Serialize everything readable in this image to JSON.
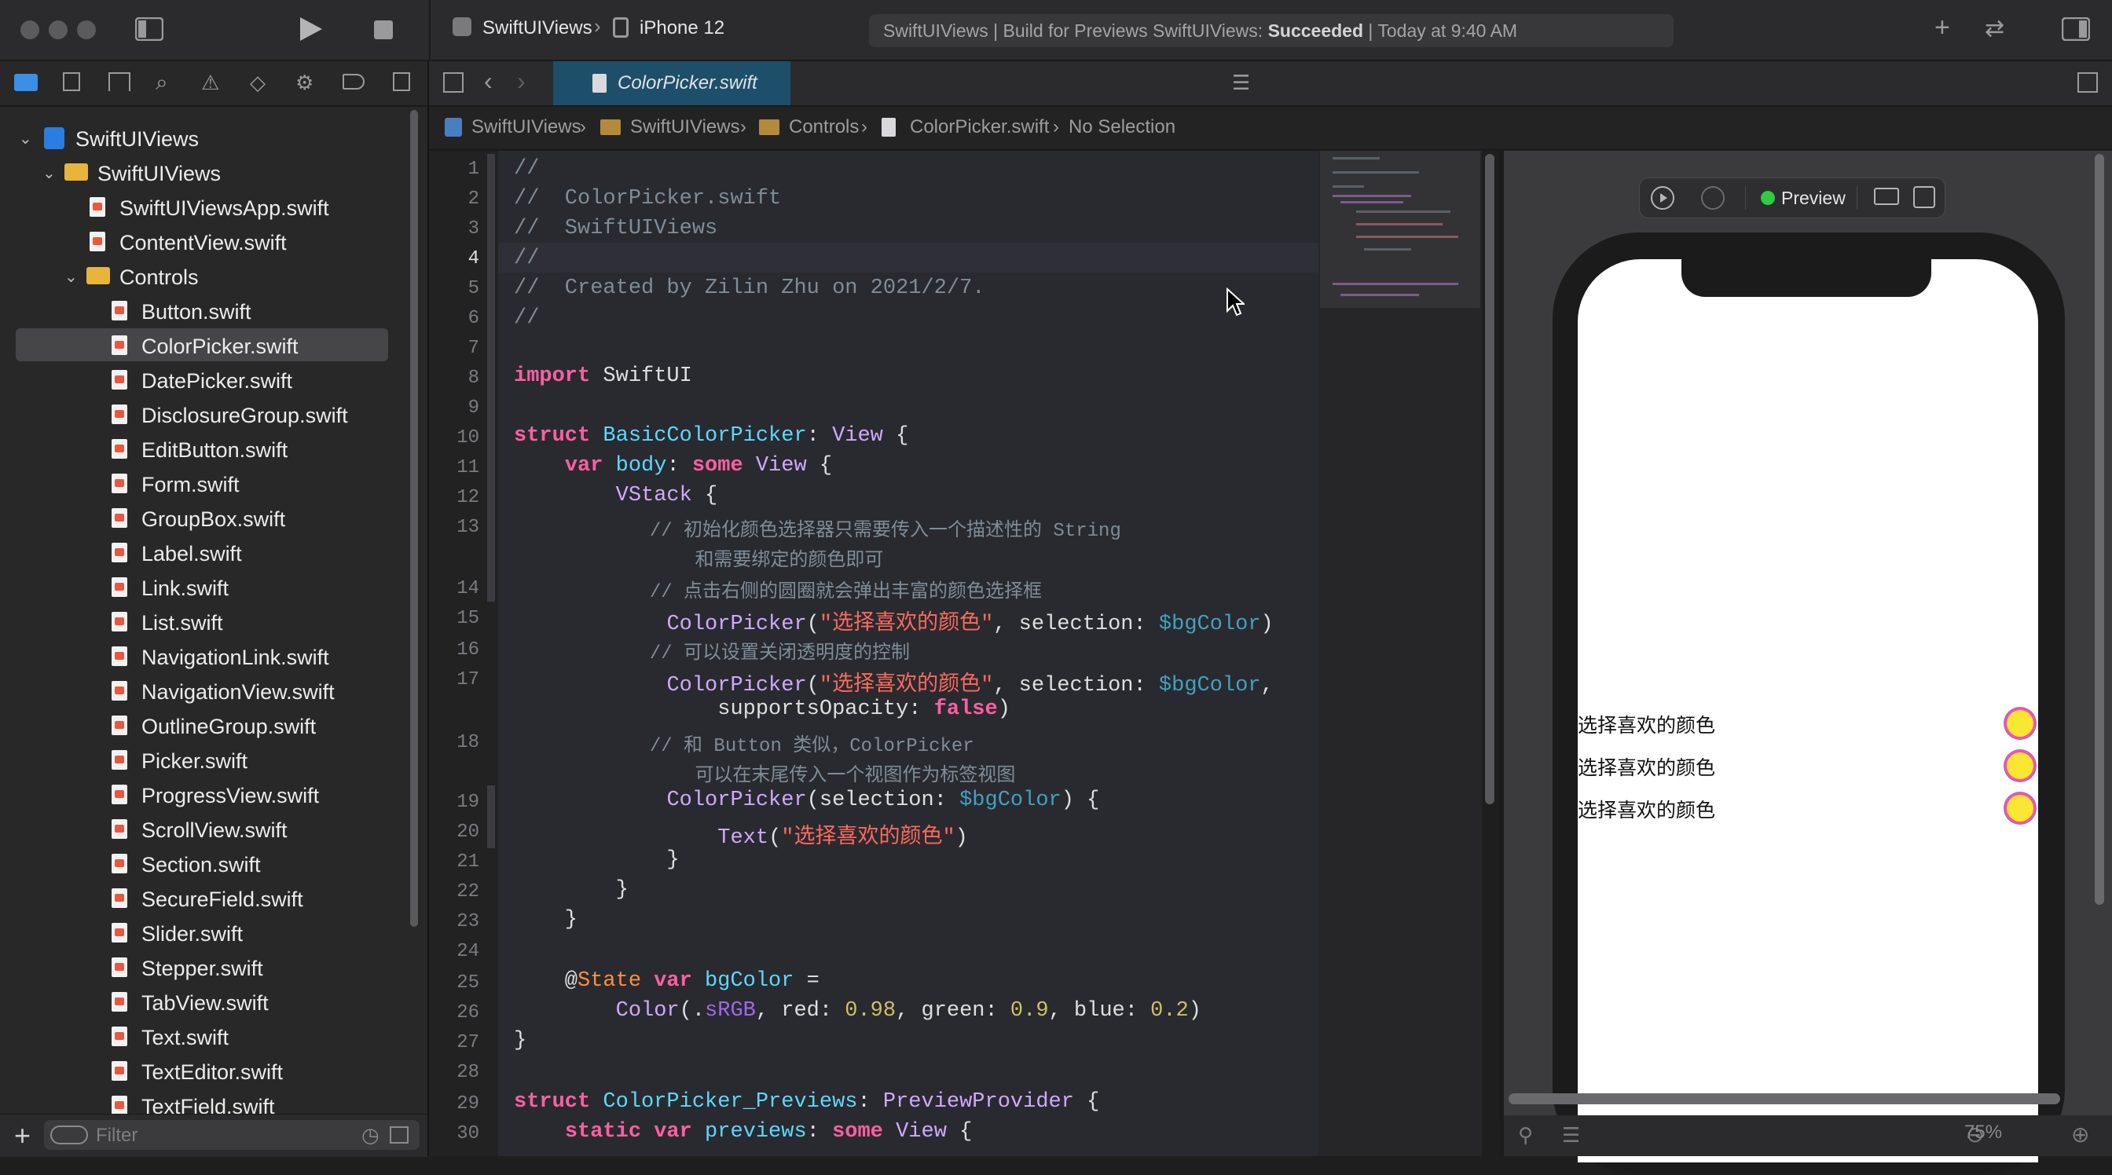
{
  "toolbar": {
    "scheme": "SwiftUIViews",
    "device": "iPhone 12",
    "status_prefix": "SwiftUIViews | Build for Previews SwiftUIViews: ",
    "status_result": "Succeeded",
    "status_time": " | Today at 9:40 AM"
  },
  "navigator": {
    "project": "SwiftUIViews",
    "group": "SwiftUIViews",
    "files_top": [
      "SwiftUIViewsApp.swift",
      "ContentView.swift"
    ],
    "subgroup": "Controls",
    "files": [
      "Button.swift",
      "ColorPicker.swift",
      "DatePicker.swift",
      "DisclosureGroup.swift",
      "EditButton.swift",
      "Form.swift",
      "GroupBox.swift",
      "Label.swift",
      "Link.swift",
      "List.swift",
      "NavigationLink.swift",
      "NavigationView.swift",
      "OutlineGroup.swift",
      "Picker.swift",
      "ProgressView.swift",
      "ScrollView.swift",
      "Section.swift",
      "SecureField.swift",
      "Slider.swift",
      "Stepper.swift",
      "TabView.swift",
      "Text.swift",
      "TextEditor.swift",
      "TextField.swift"
    ],
    "selected": "ColorPicker.swift",
    "filter_placeholder": "Filter"
  },
  "editor": {
    "tab": "ColorPicker.swift",
    "jumpbar": [
      "SwiftUIViews",
      "SwiftUIViews",
      "Controls",
      "ColorPicker.swift",
      "No Selection"
    ],
    "line_numbers": [
      "1",
      "2",
      "3",
      "4",
      "5",
      "6",
      "7",
      "8",
      "9",
      "10",
      "11",
      "12",
      "13",
      "",
      "14",
      "15",
      "16",
      "17",
      "",
      "18",
      "",
      "19",
      "20",
      "21",
      "22",
      "23",
      "24",
      "25",
      "26",
      "27",
      "28",
      "29",
      "30"
    ]
  },
  "preview": {
    "label": "Preview",
    "rows": [
      "选择喜欢的颜色",
      "选择喜欢的颜色",
      "选择喜欢的颜色"
    ],
    "swatch_color": "#fae633",
    "zoom": "75%"
  },
  "colors": {
    "accent": "#1d4f6b",
    "keyword": "#fc5fa3",
    "string": "#fc6a5d",
    "number": "#d0bf69",
    "comment": "#7f8c98",
    "status_ok": "#2ecc40"
  }
}
